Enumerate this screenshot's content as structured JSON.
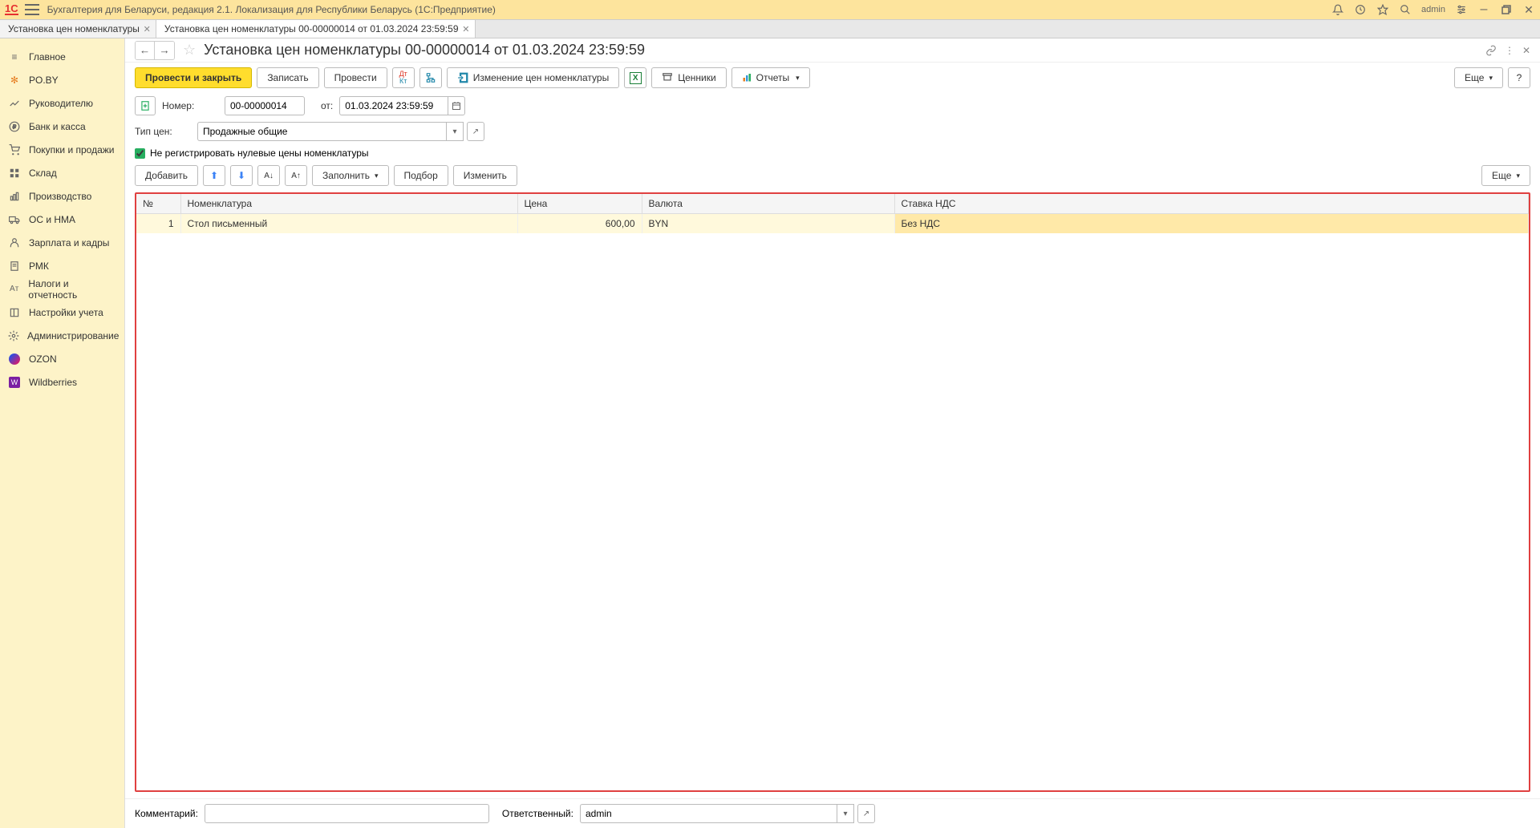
{
  "app": {
    "title": "Бухгалтерия для Беларуси, редакция 2.1. Локализация для Республики Беларусь   (1С:Предприятие)",
    "user": "admin"
  },
  "tabs": [
    {
      "label": "Установка цен номенклатуры",
      "active": false
    },
    {
      "label": "Установка цен номенклатуры 00-00000014 от 01.03.2024 23:59:59",
      "active": true
    }
  ],
  "sidebar": {
    "items": [
      {
        "label": "Главное",
        "icon": "menu"
      },
      {
        "label": "PO.BY",
        "icon": "poby"
      },
      {
        "label": "Руководителю",
        "icon": "chart"
      },
      {
        "label": "Банк и касса",
        "icon": "ruble"
      },
      {
        "label": "Покупки и продажи",
        "icon": "cart"
      },
      {
        "label": "Склад",
        "icon": "grid"
      },
      {
        "label": "Производство",
        "icon": "factory"
      },
      {
        "label": "ОС и НМА",
        "icon": "truck"
      },
      {
        "label": "Зарплата и кадры",
        "icon": "person"
      },
      {
        "label": "РМК",
        "icon": "receipt"
      },
      {
        "label": "Налоги и отчетность",
        "icon": "doc"
      },
      {
        "label": "Настройки учета",
        "icon": "book"
      },
      {
        "label": "Администрирование",
        "icon": "gear"
      },
      {
        "label": "OZON",
        "icon": "ozon"
      },
      {
        "label": "Wildberries",
        "icon": "wb"
      }
    ]
  },
  "doc": {
    "title": "Установка цен номенклатуры 00-00000014 от 01.03.2024 23:59:59",
    "toolbar": {
      "post_close": "Провести и закрыть",
      "save": "Записать",
      "post": "Провести",
      "price_change": "Изменение цен номенклатуры",
      "pricetags": "Ценники",
      "reports": "Отчеты",
      "more": "Еще"
    },
    "fields": {
      "number_label": "Номер:",
      "number": "00-00000014",
      "date_label": "от:",
      "date": "01.03.2024 23:59:59",
      "price_type_label": "Тип цен:",
      "price_type": "Продажные общие",
      "skip_zero_label": "Не регистрировать нулевые цены номенклатуры",
      "skip_zero": true
    },
    "table_toolbar": {
      "add": "Добавить",
      "fill": "Заполнить",
      "pick": "Подбор",
      "edit": "Изменить",
      "more": "Еще"
    },
    "table": {
      "columns": [
        "№",
        "Номенклатура",
        "Цена",
        "Валюта",
        "Ставка НДС"
      ],
      "rows": [
        {
          "n": "1",
          "item": "Стол письменный",
          "price": "600,00",
          "currency": "BYN",
          "vat": "Без НДС"
        }
      ]
    },
    "footer": {
      "comment_label": "Комментарий:",
      "comment": "",
      "responsible_label": "Ответственный:",
      "responsible": "admin"
    }
  }
}
